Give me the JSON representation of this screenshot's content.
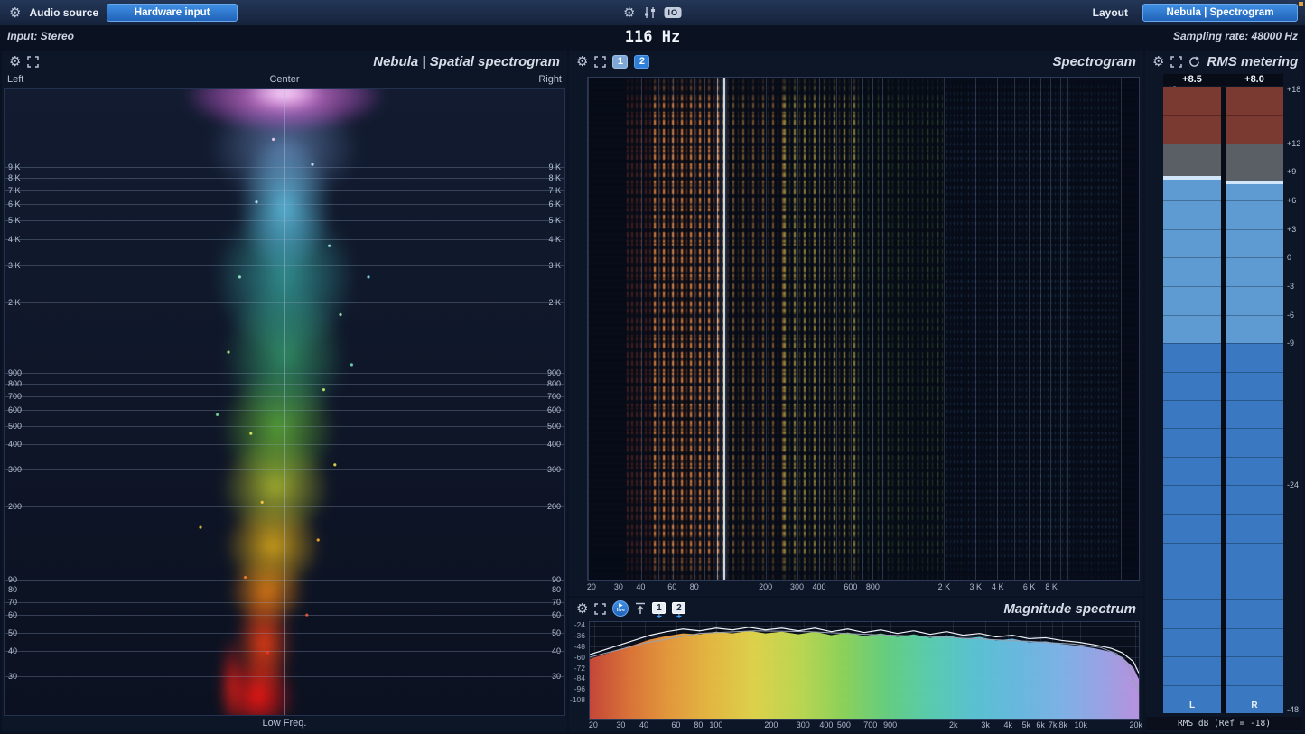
{
  "icons": {
    "gear": "⚙",
    "play": "▶"
  },
  "topbar": {
    "audio_source_label": "Audio source",
    "hardware_input_button": "Hardware input",
    "io_icon_label": "IO",
    "layout_label": "Layout",
    "layout_button": "Nebula | Spectrogram",
    "input_label": "Input: Stereo",
    "sampling_rate_label": "Sampling rate: 48000 Hz",
    "cursor_freq": "116 Hz"
  },
  "spatial": {
    "title": "Nebula | Spatial spectrogram",
    "axis_left": "Left",
    "axis_center": "Center",
    "axis_right": "Right",
    "axis_bottom": "Low Freq.",
    "freq_labels": [
      {
        "label": "9 K",
        "top": "12.4%"
      },
      {
        "label": "8 K",
        "top": "14.2%"
      },
      {
        "label": "7 K",
        "top": "16.1%"
      },
      {
        "label": "6 K",
        "top": "18.3%"
      },
      {
        "label": "5 K",
        "top": "20.9%"
      },
      {
        "label": "4 K",
        "top": "24.0%"
      },
      {
        "label": "3 K",
        "top": "28.2%"
      },
      {
        "label": "2 K",
        "top": "34.1%"
      },
      {
        "label": "900",
        "top": "45.3%"
      },
      {
        "label": "800",
        "top": "47.1%"
      },
      {
        "label": "700",
        "top": "49.1%"
      },
      {
        "label": "600",
        "top": "51.2%"
      },
      {
        "label": "500",
        "top": "53.8%"
      },
      {
        "label": "400",
        "top": "56.7%"
      },
      {
        "label": "300",
        "top": "60.7%"
      },
      {
        "label": "200",
        "top": "66.6%"
      },
      {
        "label": "90",
        "top": "78.3%"
      },
      {
        "label": "80",
        "top": "80.0%"
      },
      {
        "label": "70",
        "top": "82.0%"
      },
      {
        "label": "60",
        "top": "84.0%"
      },
      {
        "label": "50",
        "top": "86.8%"
      },
      {
        "label": "40",
        "top": "89.8%"
      },
      {
        "label": "30",
        "top": "93.8%"
      }
    ]
  },
  "spectrogram": {
    "title": "Spectrogram",
    "layer_buttons": [
      "1",
      "2"
    ],
    "cursor_freq": "116 Hz",
    "freq_labels": [
      {
        "label": "20",
        "left": "0.8%"
      },
      {
        "label": "30",
        "left": "5.7%"
      },
      {
        "label": "40",
        "left": "9.7%"
      },
      {
        "label": "60",
        "left": "15.4%"
      },
      {
        "label": "80",
        "left": "19.4%"
      },
      {
        "label": "200",
        "left": "32.3%"
      },
      {
        "label": "300",
        "left": "38%"
      },
      {
        "label": "400",
        "left": "42%"
      },
      {
        "label": "600",
        "left": "47.7%"
      },
      {
        "label": "800",
        "left": "51.7%"
      },
      {
        "label": "2 K",
        "left": "64.6%"
      },
      {
        "label": "3 K",
        "left": "70.3%"
      },
      {
        "label": "4 K",
        "left": "74.3%"
      },
      {
        "label": "6 K",
        "left": "80%"
      },
      {
        "label": "8 K",
        "left": "84%"
      }
    ],
    "gridlines": [
      {
        "left": "0%"
      },
      {
        "left": "5.7%"
      },
      {
        "left": "9.7%"
      },
      {
        "left": "12.8%"
      },
      {
        "left": "15.4%"
      },
      {
        "left": "17.6%"
      },
      {
        "left": "19.4%"
      },
      {
        "left": "21.1%"
      },
      {
        "left": "22.6%"
      },
      {
        "left": "32.3%"
      },
      {
        "left": "38%"
      },
      {
        "left": "42%"
      },
      {
        "left": "45.1%"
      },
      {
        "left": "47.7%"
      },
      {
        "left": "49.9%"
      },
      {
        "left": "51.7%"
      },
      {
        "left": "53.4%"
      },
      {
        "left": "54.8%"
      },
      {
        "left": "64.6%"
      },
      {
        "left": "70.3%"
      },
      {
        "left": "74.3%"
      },
      {
        "left": "77.4%"
      },
      {
        "left": "80%"
      },
      {
        "left": "82.1%"
      },
      {
        "left": "84%"
      },
      {
        "left": "85.7%"
      },
      {
        "left": "87.1%"
      },
      {
        "left": "96.8%"
      }
    ]
  },
  "magnitude": {
    "title": "Magnitude spectrum",
    "live_button": "live",
    "chips": [
      "1",
      "2"
    ],
    "chip_plus": "+",
    "db_labels": [
      {
        "label": "-24",
        "top": "3.6%"
      },
      {
        "label": "-36",
        "top": "14.5%"
      },
      {
        "label": "-48",
        "top": "25.5%"
      },
      {
        "label": "-60",
        "top": "36.4%"
      },
      {
        "label": "-72",
        "top": "47.3%"
      },
      {
        "label": "-84",
        "top": "58.2%"
      },
      {
        "label": "-96",
        "top": "69.1%"
      },
      {
        "label": "-108",
        "top": "80%"
      }
    ],
    "freq_labels": [
      {
        "label": "20",
        "left": "0.8%"
      },
      {
        "label": "30",
        "left": "5.8%"
      },
      {
        "label": "40",
        "left": "10%"
      },
      {
        "label": "60",
        "left": "15.8%"
      },
      {
        "label": "80",
        "left": "19.9%"
      },
      {
        "label": "100",
        "left": "23.1%"
      },
      {
        "label": "200",
        "left": "33.1%"
      },
      {
        "label": "300",
        "left": "38.9%"
      },
      {
        "label": "400",
        "left": "43.1%"
      },
      {
        "label": "500",
        "left": "46.3%"
      },
      {
        "label": "700",
        "left": "51.1%"
      },
      {
        "label": "900",
        "left": "54.7%"
      },
      {
        "label": "2k",
        "left": "66.2%"
      },
      {
        "label": "3k",
        "left": "72%"
      },
      {
        "label": "4k",
        "left": "76.1%"
      },
      {
        "label": "5k",
        "left": "79.4%"
      },
      {
        "label": "6k",
        "left": "82%"
      },
      {
        "label": "7k",
        "left": "84.2%"
      },
      {
        "label": "8k",
        "left": "86.1%"
      },
      {
        "label": "10k",
        "left": "89.3%"
      },
      {
        "label": "20k",
        "left": "99.3%"
      }
    ],
    "ylim": [
      -20,
      -130
    ],
    "curve_main": [
      [
        0,
        -62
      ],
      [
        4,
        -54
      ],
      [
        8,
        -46
      ],
      [
        11,
        -40
      ],
      [
        14,
        -36
      ],
      [
        17,
        -33
      ],
      [
        20,
        -34
      ],
      [
        23,
        -31
      ],
      [
        26,
        -33
      ],
      [
        29,
        -30
      ],
      [
        32,
        -33
      ],
      [
        35,
        -31
      ],
      [
        38,
        -34
      ],
      [
        41,
        -31
      ],
      [
        44,
        -35
      ],
      [
        47,
        -32
      ],
      [
        50,
        -36
      ],
      [
        53,
        -33
      ],
      [
        56,
        -37
      ],
      [
        59,
        -34
      ],
      [
        62,
        -38
      ],
      [
        65,
        -35
      ],
      [
        68,
        -39
      ],
      [
        71,
        -37
      ],
      [
        74,
        -41
      ],
      [
        77,
        -39
      ],
      [
        80,
        -43
      ],
      [
        83,
        -42
      ],
      [
        86,
        -45
      ],
      [
        89,
        -47
      ],
      [
        92,
        -50
      ],
      [
        95,
        -54
      ],
      [
        97,
        -60
      ],
      [
        99,
        -72
      ],
      [
        100,
        -85
      ]
    ],
    "curve_peak": [
      [
        0,
        -57
      ],
      [
        4,
        -49
      ],
      [
        8,
        -41
      ],
      [
        11,
        -35
      ],
      [
        14,
        -31
      ],
      [
        17,
        -28
      ],
      [
        20,
        -30
      ],
      [
        23,
        -27
      ],
      [
        26,
        -29
      ],
      [
        29,
        -26
      ],
      [
        32,
        -29
      ],
      [
        35,
        -27
      ],
      [
        38,
        -30
      ],
      [
        41,
        -27
      ],
      [
        44,
        -31
      ],
      [
        47,
        -28
      ],
      [
        50,
        -32
      ],
      [
        53,
        -29
      ],
      [
        56,
        -33
      ],
      [
        59,
        -30
      ],
      [
        62,
        -34
      ],
      [
        65,
        -31
      ],
      [
        68,
        -35
      ],
      [
        71,
        -33
      ],
      [
        74,
        -37
      ],
      [
        77,
        -35
      ],
      [
        80,
        -39
      ],
      [
        83,
        -38
      ],
      [
        86,
        -41
      ],
      [
        89,
        -43
      ],
      [
        92,
        -46
      ],
      [
        95,
        -50
      ],
      [
        97,
        -55
      ],
      [
        99,
        -65
      ],
      [
        100,
        -78
      ]
    ],
    "curve_gray": [
      [
        0,
        -60
      ],
      [
        10,
        -44
      ],
      [
        20,
        -33
      ],
      [
        30,
        -30
      ],
      [
        40,
        -31
      ],
      [
        50,
        -34
      ],
      [
        60,
        -36
      ],
      [
        70,
        -39
      ],
      [
        80,
        -42
      ],
      [
        88,
        -45
      ],
      [
        93,
        -49
      ],
      [
        96,
        -56
      ],
      [
        98,
        -70
      ],
      [
        100,
        -100
      ]
    ],
    "gradient": [
      {
        "offset": "0%",
        "color": "#d24a3a"
      },
      {
        "offset": "7%",
        "color": "#e8793a"
      },
      {
        "offset": "14%",
        "color": "#f2a03e"
      },
      {
        "offset": "22%",
        "color": "#f2c344"
      },
      {
        "offset": "30%",
        "color": "#ecdf4e"
      },
      {
        "offset": "38%",
        "color": "#c9e455"
      },
      {
        "offset": "46%",
        "color": "#96df5e"
      },
      {
        "offset": "54%",
        "color": "#6cdb86"
      },
      {
        "offset": "62%",
        "color": "#5fd9b8"
      },
      {
        "offset": "70%",
        "color": "#5fcede"
      },
      {
        "offset": "78%",
        "color": "#6fc4ec"
      },
      {
        "offset": "86%",
        "color": "#86bdf4"
      },
      {
        "offset": "93%",
        "color": "#a2aef2"
      },
      {
        "offset": "100%",
        "color": "#c49aec"
      }
    ]
  },
  "rms": {
    "title": "RMS metering",
    "footer": "RMS dB (Ref = -18)",
    "scale_labels": [
      {
        "label": "+18",
        "top": "0.4%"
      },
      {
        "label": "+12",
        "top": "9.1%"
      },
      {
        "label": "+9",
        "top": "13.6%"
      },
      {
        "label": "+6",
        "top": "18.2%"
      },
      {
        "label": "+3",
        "top": "22.7%"
      },
      {
        "label": "0",
        "top": "27.3%"
      },
      {
        "label": "-3",
        "top": "31.8%"
      },
      {
        "label": "-6",
        "top": "36.4%"
      },
      {
        "label": "-9",
        "top": "40.9%"
      },
      {
        "label": "-24",
        "top": "63.6%"
      },
      {
        "label": "-48",
        "top": "99.4%"
      }
    ],
    "ticks": [
      {
        "top": "4.5%"
      },
      {
        "top": "9.1%"
      },
      {
        "top": "13.6%"
      },
      {
        "top": "18.2%"
      },
      {
        "top": "22.7%"
      },
      {
        "top": "27.3%"
      },
      {
        "top": "31.8%"
      },
      {
        "top": "36.4%"
      },
      {
        "top": "40.9%"
      },
      {
        "top": "45.5%"
      },
      {
        "top": "50%"
      },
      {
        "top": "54.5%"
      },
      {
        "top": "59.1%"
      },
      {
        "top": "63.6%"
      },
      {
        "top": "68.2%"
      },
      {
        "top": "72.7%"
      },
      {
        "top": "77.3%"
      },
      {
        "top": "81.8%"
      },
      {
        "top": "86.4%"
      },
      {
        "top": "90.9%"
      },
      {
        "top": "95.5%"
      }
    ],
    "meters": [
      {
        "name": "L",
        "value": "+8.5",
        "segments": [
          {
            "top": "0%",
            "height": "9.1%",
            "color": "#7b3a31"
          },
          {
            "top": "9.1%",
            "height": "5.3%",
            "color": "#5a5f66"
          },
          {
            "top": "14.2%",
            "height": "0.6%",
            "color": "#d2e6f9"
          },
          {
            "top": "14.8%",
            "height": "26.1%",
            "color": "#5e9bd3"
          },
          {
            "top": "40.9%",
            "height": "59.1%",
            "color": "#3a79c1"
          }
        ]
      },
      {
        "name": "R",
        "value": "+8.0",
        "segments": [
          {
            "top": "0%",
            "height": "9.1%",
            "color": "#7b3a31"
          },
          {
            "top": "9.1%",
            "height": "6.0%",
            "color": "#5a5f66"
          },
          {
            "top": "15.0%",
            "height": "0.6%",
            "color": "#d2e6f9"
          },
          {
            "top": "15.6%",
            "height": "25.3%",
            "color": "#5e9bd3"
          },
          {
            "top": "40.9%",
            "height": "59.1%",
            "color": "#3a79c1"
          }
        ]
      }
    ]
  }
}
